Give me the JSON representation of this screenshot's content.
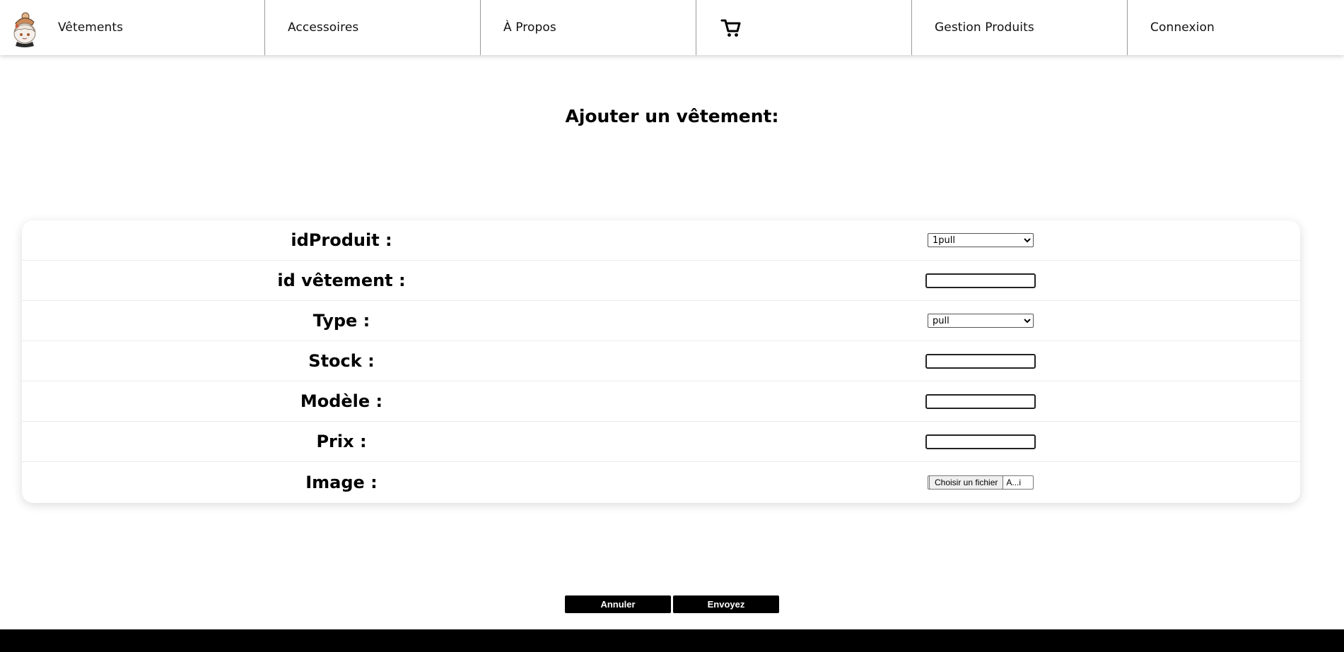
{
  "nav": {
    "items": [
      {
        "label": "Vêtements"
      },
      {
        "label": "Accessoires"
      },
      {
        "label": "À Propos"
      },
      {
        "label": ""
      },
      {
        "label": "Gestion Produits"
      },
      {
        "label": "Connexion"
      }
    ],
    "logo_icon": "character-avatar-logo",
    "cart_icon": "shopping-cart-icon"
  },
  "page": {
    "title": "Ajouter un vêtement:"
  },
  "form": {
    "idproduit_label": "idProduit :",
    "idproduit_value": "1pull",
    "idvetement_label": "id vêtement :",
    "idvetement_value": "",
    "type_label": "Type :",
    "type_value": "pull",
    "stock_label": "Stock :",
    "stock_value": "",
    "modele_label": "Modèle :",
    "modele_value": "",
    "prix_label": "Prix :",
    "prix_value": "",
    "image_label": "Image :",
    "image_button": "Choisir un fichier",
    "image_filename": "A...i"
  },
  "actions": {
    "cancel_label": "Annuler",
    "submit_label": "Envoyez"
  },
  "colors": {
    "button_bg": "#000000",
    "footer_bg": "#000000"
  }
}
